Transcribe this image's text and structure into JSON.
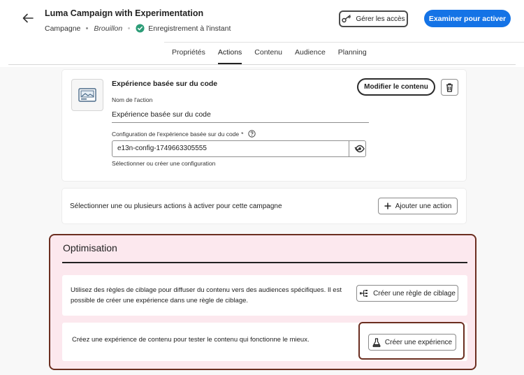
{
  "header": {
    "title": "Luma Campaign with Experimentation",
    "type": "Campagne",
    "status": "Brouillon",
    "save_status": "Enregistrement à l'instant",
    "access_button": "Gérer les accès",
    "primary_button": "Examiner pour activer",
    "accent_color": "#1473e6"
  },
  "tabs": [
    {
      "label": "Propriétés"
    },
    {
      "label": "Actions"
    },
    {
      "label": "Contenu"
    },
    {
      "label": "Audience"
    },
    {
      "label": "Planning"
    }
  ],
  "active_tab": "Actions",
  "action": {
    "title": "Expérience basée sur du code",
    "name_label": "Nom de l'action",
    "name_value": "Expérience basée sur du code",
    "config_label": "Configuration de l'expérience basée sur du code",
    "config_required": "*",
    "config_value": "e13n-config-1749663305555",
    "config_help": "Sélectionner ou créer une configuration",
    "edit_button": "Modifier le contenu"
  },
  "select_actions": {
    "text": "Sélectionner une ou plusieurs actions à activer pour cette campagne",
    "button": "Ajouter une action"
  },
  "optimisation": {
    "title": "Optimisation",
    "targeting_text": "Utilisez des règles de ciblage pour diffuser du contenu vers des audiences spécifiques. Il est possible de créer une expérience dans une règle de ciblage.",
    "targeting_button": "Créer une règle de ciblage",
    "experiment_text": "Créez une expérience de contenu pour tester le contenu qui fonctionne le mieux.",
    "experiment_button": "Créer une expérience",
    "highlight_color": "#6b2e20"
  },
  "icons": [
    "arrow-left-icon",
    "key-icon",
    "check-circle-icon",
    "image-icon",
    "trash-icon",
    "chevron-down-icon",
    "eye-icon",
    "info-icon",
    "plus-icon",
    "targeting-rule-icon",
    "beaker-icon"
  ]
}
